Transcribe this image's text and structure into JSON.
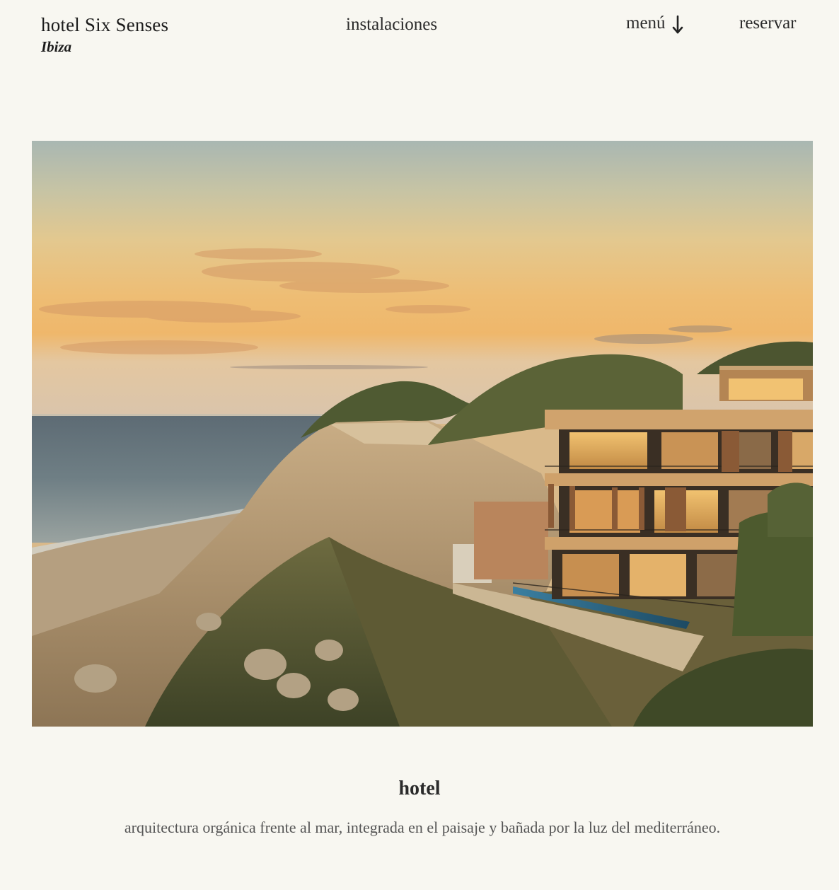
{
  "header": {
    "brand_name": "hotel Six Senses",
    "brand_location": "Ibiza",
    "nav_facilities": "instalaciones",
    "nav_menu": "menú",
    "nav_book": "reservar"
  },
  "hero": {
    "alt": "Six Senses Ibiza hotel on a cliff above the Mediterranean at sunset"
  },
  "section": {
    "title": "hotel",
    "description": "arquitectura orgánica frente al mar, integrada en el paisaje y bañada por la luz del mediterráneo."
  },
  "colors": {
    "background": "#f8f7f1",
    "text": "#222222",
    "muted_text": "#555555"
  },
  "icons": {
    "menu_arrow": "arrow-down-icon"
  }
}
